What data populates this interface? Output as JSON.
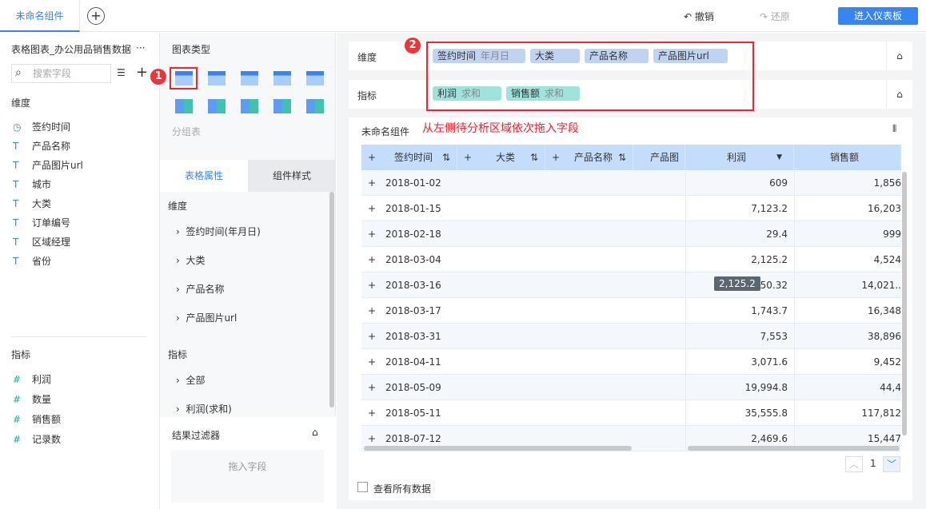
{
  "topbar": {
    "tab": "未命名组件",
    "undo": "撤销",
    "redo": "还原",
    "enter": "进入仪表板"
  },
  "left": {
    "title": "表格图表_办公用品销售数据",
    "more": "···",
    "search_placeholder": "搜索字段",
    "dim_label": "维度",
    "dimensions": [
      {
        "icon": "clock-icon",
        "label": "签约时间"
      },
      {
        "icon": "text-icon",
        "label": "产品名称"
      },
      {
        "icon": "text-icon",
        "label": "产品图片url"
      },
      {
        "icon": "text-icon",
        "label": "城市"
      },
      {
        "icon": "text-icon",
        "label": "大类"
      },
      {
        "icon": "text-icon",
        "label": "订单编号"
      },
      {
        "icon": "text-icon",
        "label": "区域经理"
      },
      {
        "icon": "text-icon",
        "label": "省份"
      }
    ],
    "measure_label": "指标",
    "measures": [
      "利润",
      "数量",
      "销售额",
      "记录数"
    ]
  },
  "mid": {
    "chart_type_label": "图表类型",
    "chart_type_name": "分组表",
    "tabs": [
      "表格属性",
      "组件样式"
    ],
    "dim_label": "维度",
    "dims": [
      "签约时间(年月日)",
      "大类",
      "产品名称",
      "产品图片url"
    ],
    "measure_label": "指标",
    "measures": [
      "全部",
      "利润(求和)"
    ],
    "filter_label": "结果过滤器",
    "drop_hint": "拖入字段"
  },
  "annotations": {
    "badge1": "1",
    "badge2": "2",
    "hint": "从左侧待分析区域依次拖入字段"
  },
  "colors": {
    "accent": "#3685f2",
    "annotation": "#f5222d"
  },
  "main": {
    "dim_label": "维度",
    "measure_label": "指标",
    "dim_pills": [
      {
        "label": "签约时间",
        "sub": "年月日"
      },
      {
        "label": "大类",
        "sub": ""
      },
      {
        "label": "产品名称",
        "sub": ""
      },
      {
        "label": "产品图片url",
        "sub": ""
      }
    ],
    "measure_pills": [
      {
        "label": "利润",
        "sub": "求和"
      },
      {
        "label": "销售额",
        "sub": "求和"
      }
    ],
    "component_title": "未命名组件",
    "table": {
      "headers": [
        "签约时间",
        "大类",
        "产品名称",
        "产品图",
        "利润",
        "销售额"
      ],
      "rows": [
        [
          "2018-01-02",
          "609",
          "1,856"
        ],
        [
          "2018-01-15",
          "7,123.2",
          "16,203"
        ],
        [
          "2018-02-18",
          "29.4",
          "999"
        ],
        [
          "2018-03-04",
          "2,125.2",
          "4,524"
        ],
        [
          "2018-03-16",
          "3,650.32",
          "14,021.."
        ],
        [
          "2018-03-17",
          "1,743.7",
          "16,348"
        ],
        [
          "2018-03-31",
          "7,553",
          "38,896"
        ],
        [
          "2018-04-11",
          "3,071.6",
          "9,452"
        ],
        [
          "2018-05-09",
          "19,994.8",
          "44,4"
        ],
        [
          "2018-05-11",
          "35,555.8",
          "117,812"
        ],
        [
          "2018-07-12",
          "2,469.6",
          "15,447"
        ]
      ]
    },
    "tooltip": "2,125.2",
    "page": "1",
    "show_all": "查看所有数据"
  }
}
